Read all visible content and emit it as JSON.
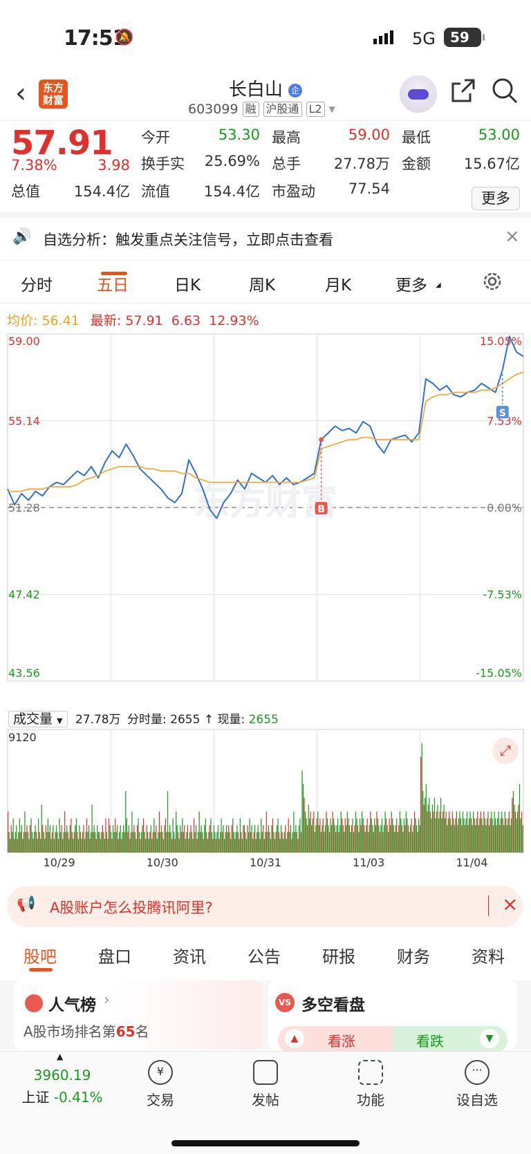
{
  "status_bar": {
    "time": "17:51",
    "network": "5G",
    "battery": "59"
  },
  "header": {
    "logo_text": "东方\n财富",
    "title": "长白山",
    "title_badge": "企",
    "code": "603099",
    "tags": [
      "融",
      "沪股通",
      "L2"
    ]
  },
  "quote": {
    "price": "57.91",
    "change_pct": "7.38%",
    "change": "3.98",
    "rows": [
      [
        {
          "label": "今开",
          "value": "53.30",
          "color": "green"
        },
        {
          "label": "最高",
          "value": "59.00",
          "color": "red"
        },
        {
          "label": "最低",
          "value": "53.00",
          "color": "green"
        }
      ],
      [
        {
          "label": "换手实",
          "value": "25.69%",
          "color": "dark"
        },
        {
          "label": "总手",
          "value": "27.78万",
          "color": "dark"
        },
        {
          "label": "金额",
          "value": "15.67亿",
          "color": "dark"
        }
      ],
      [
        {
          "label": "总值",
          "value": "154.4亿",
          "color": "dark"
        },
        {
          "label": "流值",
          "value": "154.4亿",
          "color": "dark"
        },
        {
          "label": "市盈动",
          "value": "77.54",
          "color": "dark"
        }
      ]
    ],
    "more_label": "更多"
  },
  "notice": {
    "text": "自选分析：触发重点关注信号，立即点击查看"
  },
  "tabs": {
    "items": [
      "分时",
      "五日",
      "日K",
      "周K",
      "月K",
      "更多"
    ],
    "active": "五日"
  },
  "chart_header": {
    "avg_label": "均价:",
    "avg_value": "56.41",
    "latest_label": "最新:",
    "latest_value": "57.91",
    "latest_change": "6.63",
    "latest_pct": "12.93%"
  },
  "chart_data": {
    "type": "line",
    "x_labels": [
      "10/29",
      "10/30",
      "10/31",
      "11/03",
      "11/04"
    ],
    "y_ticks_left": [
      "59.00",
      "55.14",
      "51.28",
      "47.42",
      "43.56"
    ],
    "y_ticks_right": [
      "15.05%",
      "7.53%",
      "0.00%",
      "-7.53%",
      "-15.05%"
    ],
    "ylim": [
      43.56,
      59.0
    ],
    "prev_close": 51.28,
    "series": [
      {
        "name": "最新",
        "color": "#2f6fcf",
        "values": [
          52.1,
          51.4,
          51.9,
          51.6,
          52.0,
          51.8,
          52.2,
          52.4,
          52.3,
          52.6,
          52.9,
          52.7,
          53.1,
          52.6,
          53.3,
          53.8,
          53.5,
          54.1,
          53.6,
          53.0,
          52.7,
          52.4,
          52.1,
          51.7,
          51.5,
          51.9,
          53.4,
          52.8,
          52.1,
          51.2,
          50.8,
          51.5,
          51.9,
          52.5,
          52.1,
          52.8,
          52.6,
          52.4,
          52.7,
          52.3,
          52.6,
          52.3,
          52.4,
          52.6,
          52.8,
          54.3,
          54.6,
          54.9,
          54.7,
          54.8,
          54.6,
          55.1,
          54.9,
          54.1,
          53.7,
          54.3,
          54.4,
          54.5,
          54.2,
          54.6,
          57.0,
          56.8,
          56.5,
          56.7,
          56.3,
          56.2,
          56.4,
          56.5,
          56.8,
          56.6,
          56.4,
          57.4,
          58.9,
          58.2,
          58.0
        ]
      },
      {
        "name": "均价",
        "color": "#f2a93b",
        "values": [
          52.0,
          52.0,
          52.0,
          52.1,
          52.1,
          52.1,
          52.2,
          52.2,
          52.2,
          52.2,
          52.3,
          52.5,
          52.6,
          52.7,
          52.9,
          53.0,
          53.1,
          53.1,
          53.1,
          53.1,
          53.0,
          53.0,
          52.9,
          52.9,
          52.9,
          52.8,
          52.8,
          52.6,
          52.5,
          52.4,
          52.4,
          52.4,
          52.4,
          52.4,
          52.4,
          52.4,
          52.4,
          52.4,
          52.4,
          52.4,
          52.4,
          52.4,
          52.4,
          52.5,
          52.6,
          53.9,
          54.0,
          54.1,
          54.2,
          54.3,
          54.3,
          54.4,
          54.4,
          54.3,
          54.3,
          54.3,
          54.3,
          54.3,
          54.3,
          54.3,
          56.0,
          56.2,
          56.3,
          56.3,
          56.4,
          56.4,
          56.4,
          56.4,
          56.5,
          56.5,
          56.6,
          56.8,
          57.0,
          57.2,
          57.3
        ]
      }
    ],
    "markers": [
      {
        "label": "B",
        "color": "#e8584a"
      },
      {
        "label": "S",
        "color": "#5a8fe0"
      }
    ],
    "watermark": "东方财富"
  },
  "volume": {
    "select_label": "成交量",
    "total": "27.78万",
    "tick_label": "分时量:",
    "tick_value": "2655",
    "now_label": "现量:",
    "now_value": "2655",
    "max_label": "9120",
    "bars": [
      6,
      3,
      2,
      4,
      3,
      5,
      2,
      3,
      4,
      2,
      3,
      5,
      3,
      4,
      2,
      3,
      6,
      3,
      4,
      3,
      2,
      4,
      5,
      3,
      2,
      3,
      4,
      3,
      2,
      5,
      3,
      2,
      7,
      4,
      3,
      2,
      4,
      3,
      5,
      3,
      4,
      2,
      3,
      4,
      2,
      3,
      4,
      3,
      2,
      5,
      3,
      4,
      2,
      3,
      6,
      3,
      4,
      3,
      2,
      4,
      5,
      3,
      2,
      3,
      4,
      5,
      3,
      2,
      4,
      3,
      2,
      3,
      4,
      2,
      3,
      5,
      3,
      4,
      2,
      3,
      7,
      3,
      4,
      3,
      2,
      4,
      3,
      3,
      2,
      3,
      4,
      3,
      2,
      5,
      3,
      2,
      5,
      4,
      3,
      2,
      4,
      3,
      5,
      3,
      4,
      2,
      3,
      4,
      2,
      3,
      4,
      3,
      9,
      5,
      3,
      4,
      2,
      3,
      6,
      3,
      4,
      3,
      2,
      4,
      5,
      3,
      2,
      3,
      4,
      5,
      3,
      2,
      4,
      3,
      2,
      3,
      4,
      2,
      3,
      5,
      3,
      4,
      2,
      3,
      6,
      3,
      4,
      3,
      2,
      4,
      5,
      3,
      9,
      3,
      4,
      3,
      2,
      5,
      3,
      2,
      6,
      4,
      3,
      2,
      4,
      3,
      5,
      3,
      4,
      2,
      3,
      4,
      2,
      3,
      4,
      3,
      2,
      5,
      3,
      4,
      2,
      3,
      6,
      3,
      4,
      3,
      2,
      4,
      5,
      3,
      2,
      3,
      4,
      5,
      3,
      2,
      4,
      3,
      2,
      3,
      4,
      2,
      3,
      5,
      3,
      4,
      2,
      3,
      4,
      3,
      4,
      3,
      2,
      4,
      5,
      3,
      2,
      3,
      4,
      3,
      2,
      5,
      3,
      2,
      4,
      4,
      3,
      2,
      4,
      3,
      5,
      3,
      4,
      2,
      3,
      4,
      2,
      3,
      4,
      3,
      2,
      5,
      3,
      4,
      2,
      3,
      6,
      3,
      4,
      3,
      2,
      4,
      5,
      3,
      2,
      3,
      4,
      5,
      3,
      2,
      4,
      3,
      2,
      3,
      4,
      2,
      3,
      5,
      3,
      4,
      2,
      3,
      6,
      3,
      4,
      3,
      2,
      4,
      5,
      3,
      12,
      10,
      8,
      6,
      5,
      4,
      7,
      5,
      6,
      4,
      5,
      6,
      3,
      4,
      5,
      6,
      4,
      5,
      3,
      4,
      5,
      3,
      4,
      6,
      5,
      4,
      3,
      5,
      4,
      6,
      5,
      4,
      3,
      4,
      5,
      3,
      4,
      6,
      5,
      4,
      3,
      5,
      4,
      6,
      5,
      4,
      3,
      4,
      5,
      3,
      4,
      6,
      5,
      4,
      3,
      5,
      4,
      6,
      5,
      4,
      3,
      4,
      5,
      3,
      4,
      6,
      5,
      4,
      3,
      5,
      4,
      6,
      5,
      4,
      3,
      4,
      5,
      3,
      4,
      6,
      5,
      4,
      3,
      5,
      4,
      6,
      5,
      4,
      3,
      4,
      5,
      3,
      4,
      6,
      5,
      4,
      3,
      5,
      4,
      6,
      5,
      4,
      3,
      4,
      5,
      3,
      4,
      6,
      5,
      4,
      3,
      5,
      4,
      14,
      16,
      9,
      7,
      8,
      10,
      6,
      7,
      8,
      6,
      5,
      7,
      6,
      8,
      5,
      6,
      7,
      5,
      6,
      8,
      5,
      6,
      7,
      5,
      6,
      4,
      5,
      6,
      5,
      4,
      6,
      5,
      4,
      5,
      6,
      4,
      5,
      6,
      5,
      4,
      6,
      5,
      4,
      5,
      6,
      4,
      5,
      6,
      5,
      4,
      6,
      5,
      4,
      5,
      6,
      4,
      5,
      6,
      5,
      4,
      6,
      5,
      4,
      5,
      6,
      4,
      5,
      6,
      5,
      4,
      6,
      5,
      4,
      5,
      6,
      4,
      5,
      6,
      5,
      4,
      6,
      5,
      4,
      5,
      6,
      4,
      5,
      8,
      9,
      7,
      6,
      5,
      6,
      7,
      10,
      5,
      6,
      4
    ]
  },
  "ad": {
    "text": "A股账户怎么投腾讯阿里?"
  },
  "subtabs": {
    "items": [
      "股吧",
      "盘口",
      "资讯",
      "公告",
      "研报",
      "财务",
      "资料"
    ],
    "active": "股吧"
  },
  "cards": {
    "popular": {
      "title": "人气榜",
      "rank_text_prefix": "A股市场排名第",
      "rank": "65",
      "rank_suffix": "名"
    },
    "vs": {
      "badge": "VS",
      "title": "多空看盘",
      "bull": "看涨",
      "bear": "看跌"
    }
  },
  "bottom_nav": {
    "index_value": "3960.19",
    "index_name": "上证",
    "index_change": "-0.41%",
    "items": [
      "交易",
      "发帖",
      "功能",
      "设自选"
    ]
  }
}
